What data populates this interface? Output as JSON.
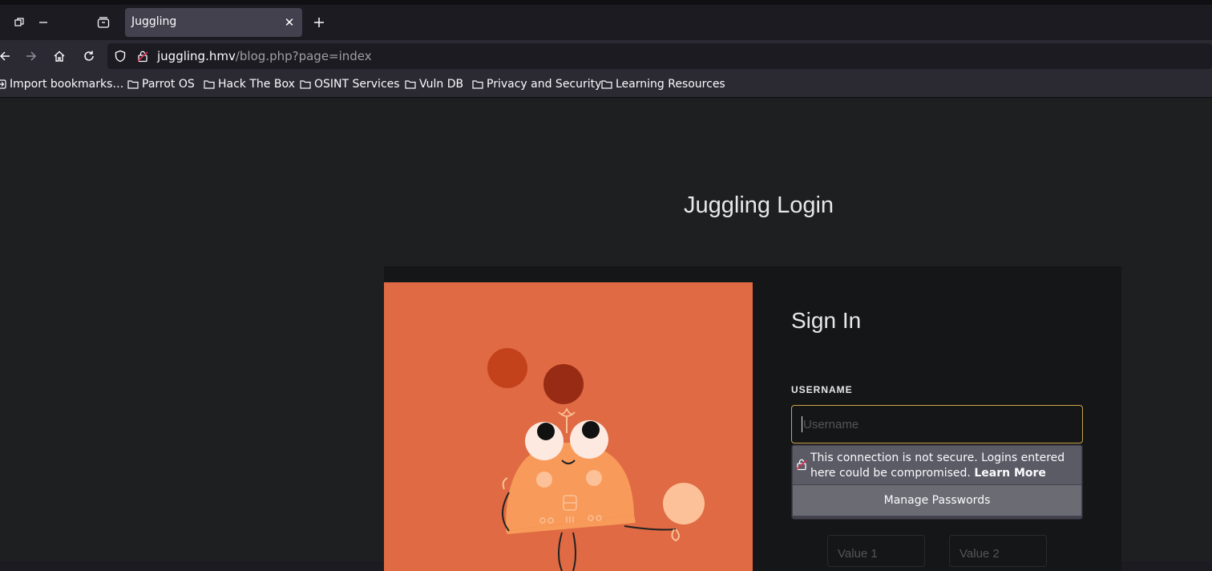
{
  "browser": {
    "tab": {
      "title": "Juggling"
    },
    "url": {
      "host": "juggling.hmv",
      "path": "/blog.php?page=index"
    },
    "bookmarks": [
      {
        "label": "Import bookmarks…",
        "icon": "import-icon"
      },
      {
        "label": "Parrot OS",
        "icon": "folder-icon"
      },
      {
        "label": "Hack The Box",
        "icon": "folder-icon"
      },
      {
        "label": "OSINT Services",
        "icon": "folder-icon"
      },
      {
        "label": "Vuln DB",
        "icon": "folder-icon"
      },
      {
        "label": "Privacy and Security",
        "icon": "folder-icon"
      },
      {
        "label": "Learning Resources",
        "icon": "folder-icon"
      }
    ]
  },
  "page": {
    "title": "Juggling Login",
    "signin_heading": "Sign In",
    "username_label": "USERNAME",
    "username_placeholder": "Username",
    "value1_placeholder": "Value 1",
    "value2_placeholder": "Value 2"
  },
  "password_popup": {
    "warning": "This connection is not secure. Logins entered here could be compromised.",
    "learn_more": "Learn More",
    "manage": "Manage Passwords"
  },
  "colors": {
    "art_background": "#df6a43",
    "input_focus_border": "#c8a64a",
    "insecure_lock": "#e22850"
  }
}
